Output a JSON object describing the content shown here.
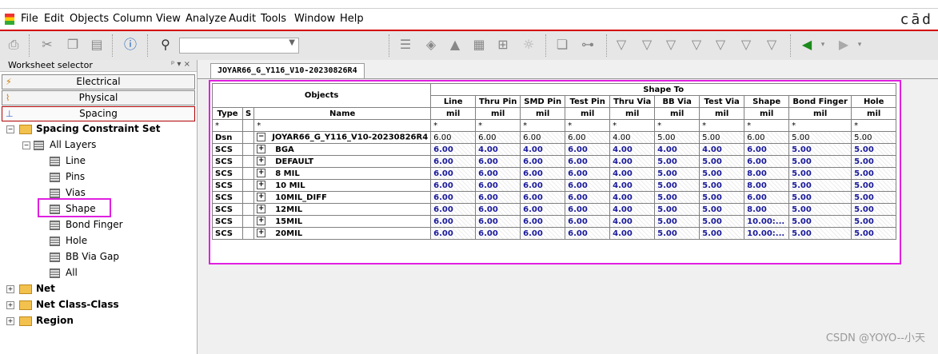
{
  "menu": [
    "File",
    "Edit",
    "Objects",
    "Column",
    "View",
    "Analyze",
    "Audit",
    "Tools",
    "Window",
    "Help"
  ],
  "brand": "cād",
  "toolbar": {
    "combo_value": ""
  },
  "worksheet_selector": {
    "title": "Worksheet selector",
    "categories": [
      "Electrical",
      "Physical",
      "Spacing"
    ]
  },
  "tree": {
    "root": "Spacing Constraint Set",
    "all_layers": "All Layers",
    "items": [
      "Line",
      "Pins",
      "Vias",
      "Shape",
      "Bond Finger",
      "Hole",
      "BB Via Gap",
      "All"
    ],
    "others": [
      "Net",
      "Net Class-Class",
      "Region"
    ]
  },
  "tab": {
    "label": "JOYAR66_G_Y116_V10-20230826R4"
  },
  "grid": {
    "objects_header": "Objects",
    "shape_to_header": "Shape To",
    "type_header": "Type",
    "s_header": "S",
    "name_header": "Name",
    "columns": [
      "Line",
      "Thru Pin",
      "SMD Pin",
      "Test Pin",
      "Thru Via",
      "BB Via",
      "Test Via",
      "Shape",
      "Bond Finger",
      "Hole"
    ],
    "units": [
      "mil",
      "mil",
      "mil",
      "mil",
      "mil",
      "mil",
      "mil",
      "mil",
      "mil",
      "mil"
    ],
    "filter": "*",
    "rows": [
      {
        "type": "Dsn",
        "name": "JOYAR66_G_Y116_V10-20230826R4",
        "expander": "−",
        "values": [
          "6.00",
          "6.00",
          "6.00",
          "6.00",
          "4.00",
          "5.00",
          "5.00",
          "6.00",
          "5.00",
          "5.00"
        ]
      },
      {
        "type": "SCS",
        "name": "BGA",
        "expander": "+",
        "values": [
          "6.00",
          "4.00",
          "4.00",
          "6.00",
          "4.00",
          "4.00",
          "4.00",
          "6.00",
          "5.00",
          "5.00"
        ]
      },
      {
        "type": "SCS",
        "name": "DEFAULT",
        "expander": "+",
        "values": [
          "6.00",
          "6.00",
          "6.00",
          "6.00",
          "4.00",
          "5.00",
          "5.00",
          "6.00",
          "5.00",
          "5.00"
        ]
      },
      {
        "type": "SCS",
        "name": "8 MIL",
        "expander": "+",
        "values": [
          "6.00",
          "6.00",
          "6.00",
          "6.00",
          "4.00",
          "5.00",
          "5.00",
          "8.00",
          "5.00",
          "5.00"
        ]
      },
      {
        "type": "SCS",
        "name": "10 MIL",
        "expander": "+",
        "values": [
          "6.00",
          "6.00",
          "6.00",
          "6.00",
          "4.00",
          "5.00",
          "5.00",
          "8.00",
          "5.00",
          "5.00"
        ]
      },
      {
        "type": "SCS",
        "name": "10MIL_DIFF",
        "expander": "+",
        "values": [
          "6.00",
          "6.00",
          "6.00",
          "6.00",
          "4.00",
          "5.00",
          "5.00",
          "6.00",
          "5.00",
          "5.00"
        ]
      },
      {
        "type": "SCS",
        "name": "12MIL",
        "expander": "+",
        "values": [
          "6.00",
          "6.00",
          "6.00",
          "6.00",
          "4.00",
          "5.00",
          "5.00",
          "8.00",
          "5.00",
          "5.00"
        ]
      },
      {
        "type": "SCS",
        "name": "15MIL",
        "expander": "+",
        "values": [
          "6.00",
          "6.00",
          "6.00",
          "6.00",
          "4.00",
          "5.00",
          "5.00",
          "10.00:...",
          "5.00",
          "5.00"
        ]
      },
      {
        "type": "SCS",
        "name": "20MIL",
        "expander": "+",
        "values": [
          "6.00",
          "6.00",
          "6.00",
          "6.00",
          "4.00",
          "5.00",
          "5.00",
          "10.00:...",
          "5.00",
          "5.00"
        ]
      }
    ]
  },
  "watermark": "CSDN @YOYO--小天"
}
